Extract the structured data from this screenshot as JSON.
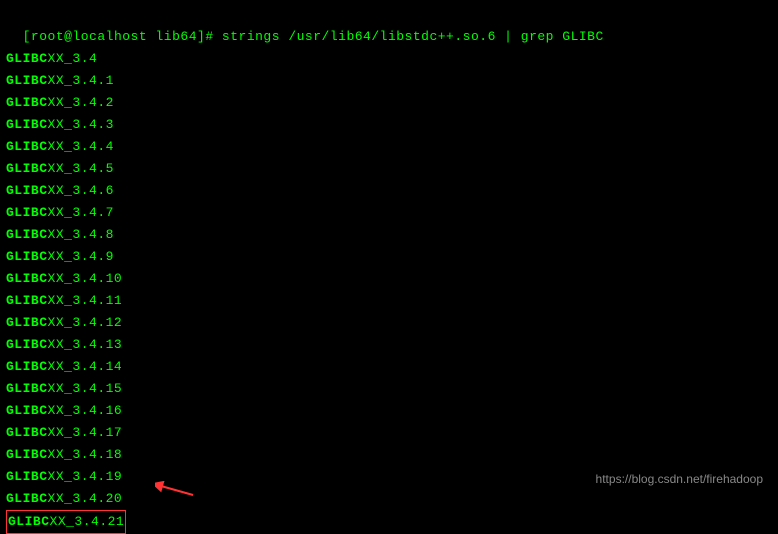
{
  "prompt": {
    "open_bracket": "[",
    "user": "root",
    "at": "@",
    "host": "localhost",
    "space": " ",
    "path": "lib64",
    "close_bracket": "]",
    "hash": "# "
  },
  "command": "strings /usr/lib64/libstdc++.so.6 | grep GLIBC",
  "output_prefix": "GLIBC",
  "output_lines": [
    "XX_3.4",
    "XX_3.4.1",
    "XX_3.4.2",
    "XX_3.4.3",
    "XX_3.4.4",
    "XX_3.4.5",
    "XX_3.4.6",
    "XX_3.4.7",
    "XX_3.4.8",
    "XX_3.4.9",
    "XX_3.4.10",
    "XX_3.4.11",
    "XX_3.4.12",
    "XX_3.4.13",
    "XX_3.4.14",
    "XX_3.4.15",
    "XX_3.4.16",
    "XX_3.4.17",
    "XX_3.4.18",
    "XX_3.4.19",
    "XX_3.4.20",
    "XX_3.4.21"
  ],
  "highlighted_index": 21,
  "watermark": "https://blog.csdn.net/firehadoop"
}
